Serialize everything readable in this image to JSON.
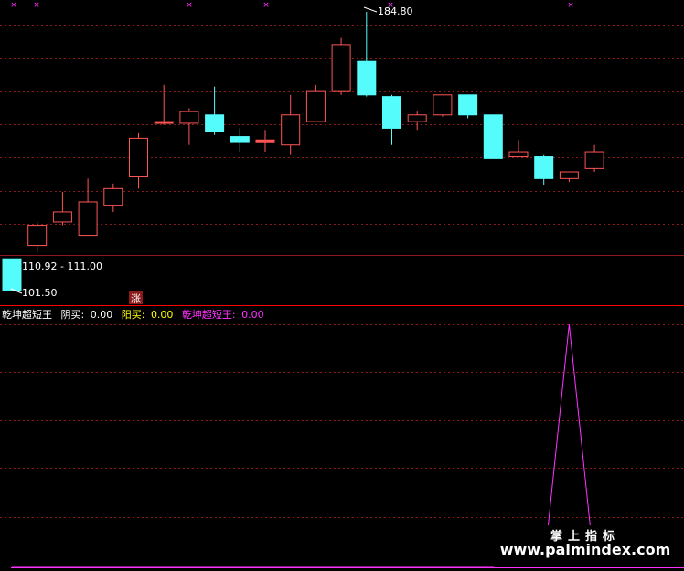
{
  "colors": {
    "up": "#ff5555",
    "down": "#54fcfc",
    "grid": "#8b1a1a",
    "separator": "#ff0000",
    "label": "#ffffff",
    "yin_buy": "#ffffff",
    "yang_buy": "#ffff00",
    "indicator": "#ff33ff",
    "zhang_badge": "#8b1a1a",
    "watermark": "#ffffff"
  },
  "price_panel": {
    "high_label": "184.80",
    "low_label": "101.50",
    "range_label": "110.92 - 111.00",
    "zhang_badge": "涨"
  },
  "indicator_panel": {
    "name": "乾坤超短王",
    "yin_buy_label": "阴买:",
    "yin_buy_value": "0.00",
    "yang_buy_label": "阳买:",
    "yang_buy_value": "0.00",
    "wang_label": "乾坤超短王:",
    "wang_value": "0.00"
  },
  "watermark": {
    "brand": "掌上指标",
    "url": "www.palmindex.com"
  },
  "chart_data": [
    {
      "type": "candlestick",
      "title": "",
      "ylim": [
        101.5,
        184.8
      ],
      "candles": [
        {
          "open": 111.0,
          "close": 101.5,
          "high": 111.0,
          "low": 101.5
        },
        {
          "open": 115.0,
          "close": 121.0,
          "high": 122.0,
          "low": 113.0
        },
        {
          "open": 122.0,
          "close": 125.0,
          "high": 131.0,
          "low": 121.0
        },
        {
          "open": 118.0,
          "close": 128.0,
          "high": 135.0,
          "low": 118.0
        },
        {
          "open": 127.0,
          "close": 132.0,
          "high": 133.5,
          "low": 125.0
        },
        {
          "open": 135.5,
          "close": 147.0,
          "high": 148.5,
          "low": 132.0
        },
        {
          "open": 152.0,
          "close": 152.0,
          "high": 163.0,
          "low": 151.0
        },
        {
          "open": 151.5,
          "close": 155.0,
          "high": 156.0,
          "low": 145.0
        },
        {
          "open": 154.0,
          "close": 149.0,
          "high": 162.5,
          "low": 148.0
        },
        {
          "open": 147.5,
          "close": 146.0,
          "high": 150.0,
          "low": 143.0
        },
        {
          "open": 146.5,
          "close": 146.5,
          "high": 149.5,
          "low": 143.0
        },
        {
          "open": 145.0,
          "close": 154.0,
          "high": 160.0,
          "low": 142.0
        },
        {
          "open": 152.0,
          "close": 161.0,
          "high": 163.0,
          "low": 152.0
        },
        {
          "open": 161.0,
          "close": 175.0,
          "high": 177.0,
          "low": 160.0
        },
        {
          "open": 170.0,
          "close": 160.0,
          "high": 184.8,
          "low": 159.5
        },
        {
          "open": 159.5,
          "close": 150.0,
          "high": 160.0,
          "low": 145.0
        },
        {
          "open": 152.0,
          "close": 154.0,
          "high": 155.0,
          "low": 149.5
        },
        {
          "open": 154.0,
          "close": 160.0,
          "high": 160.0,
          "low": 153.5
        },
        {
          "open": 160.0,
          "close": 154.0,
          "high": 160.0,
          "low": 153.0
        },
        {
          "open": 154.0,
          "close": 141.0,
          "high": 154.0,
          "low": 141.0
        },
        {
          "open": 141.5,
          "close": 143.0,
          "high": 146.5,
          "low": 141.5
        },
        {
          "open": 141.5,
          "close": 135.0,
          "high": 142.0,
          "low": 133.0
        },
        {
          "open": 135.0,
          "close": 137.0,
          "high": 137.0,
          "low": 134.0
        },
        {
          "open": 138.0,
          "close": 143.0,
          "high": 145.0,
          "low": 137.0
        }
      ]
    },
    {
      "type": "line",
      "title": "",
      "series": [
        {
          "name": "乾坤超短王",
          "values": [
            0,
            0,
            0,
            0,
            0,
            0,
            0,
            0,
            0,
            0,
            0,
            0,
            0,
            0,
            0,
            0,
            0,
            0,
            0,
            0,
            0,
            0,
            1,
            0
          ]
        }
      ]
    }
  ]
}
